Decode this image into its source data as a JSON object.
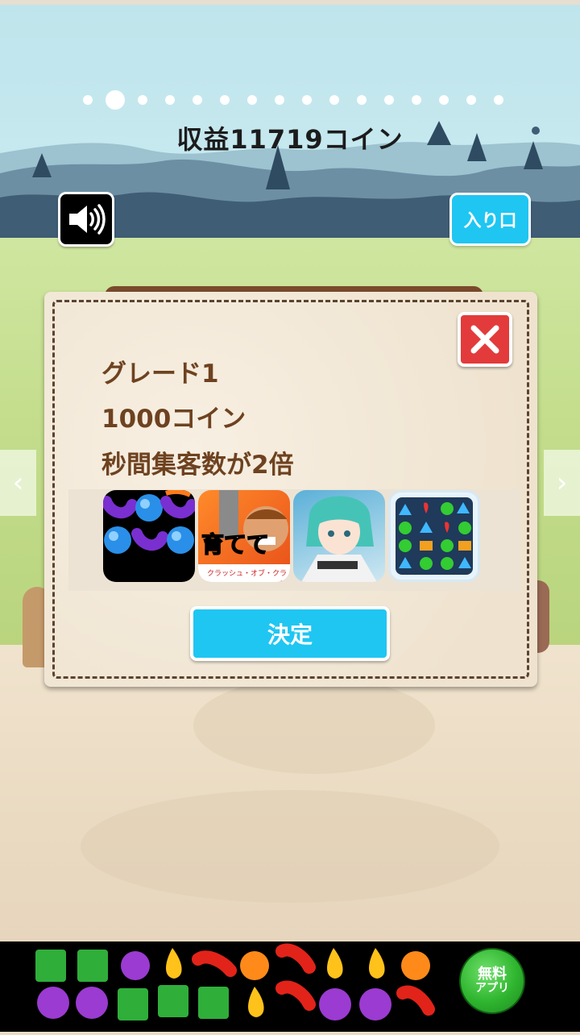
{
  "pager": {
    "count": 16,
    "active": 1
  },
  "header": {
    "income_text": "収益11719コイン"
  },
  "buttons": {
    "sound_icon": "speaker-icon",
    "entrance_label": "入り口",
    "close_icon": "close-icon",
    "confirm_label": "決定"
  },
  "nav": {
    "prev_icon": "chevron-left-icon",
    "prev_glyph": "‹",
    "next_icon": "chevron-right-icon",
    "next_glyph": "›"
  },
  "dialog": {
    "grade": "グレード1",
    "cost": "1000コイン",
    "effect": "秒間集客数が2倍"
  },
  "ads": [
    {
      "name": "candy-puzzle-app-icon",
      "caption": ""
    },
    {
      "name": "clash-of-clans-app-icon",
      "caption": "育てて",
      "subcaption": "クラッシュ・オブ・クラン"
    },
    {
      "name": "anime-girl-app-icon",
      "caption": ""
    },
    {
      "name": "jewel-match-app-icon",
      "caption": ""
    }
  ],
  "bottom_ad": {
    "badge_line1": "無料",
    "badge_line2": "アプリ"
  },
  "colors": {
    "accent": "#1fc6f2",
    "close": "#e33b3b",
    "text_brown": "#6e4220",
    "grass": "#c3dd8c"
  }
}
